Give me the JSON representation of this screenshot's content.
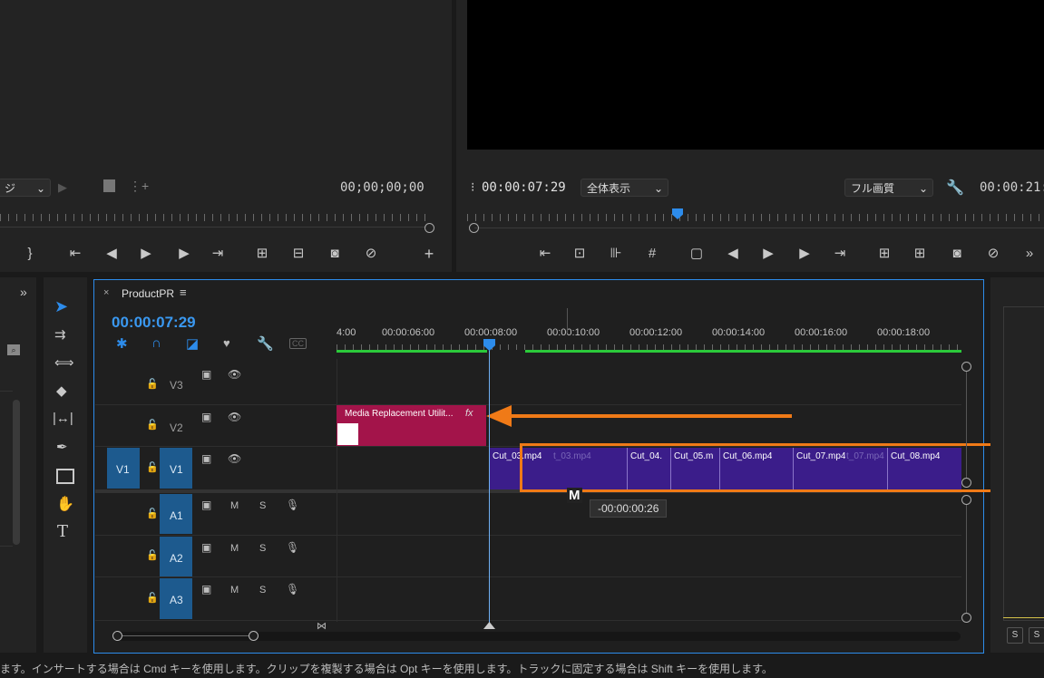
{
  "source_monitor": {
    "dropdown": "ジ",
    "timecode": "00;00;00;00"
  },
  "program_monitor": {
    "timecode": "00:00:07:29",
    "zoom": "全体表示",
    "quality": "フル画質",
    "end_timecode": "00:00:21:"
  },
  "timeline": {
    "tab_title": "ProductPR",
    "timecode": "00:00:07:29",
    "ruler": [
      "4:00",
      "00:00:06:00",
      "00:00:08:00",
      "00:00:10:00",
      "00:00:12:00",
      "00:00:14:00",
      "00:00:16:00",
      "00:00:18:00"
    ],
    "tracks": {
      "v3": "V3",
      "v2": "V2",
      "v1": "V1",
      "v1_source": "V1",
      "a1": "A1",
      "a2": "A2",
      "a3": "A3"
    },
    "audio_m": "M",
    "audio_s": "S",
    "adjustment_clip": {
      "name": "Media Replacement Utilit...",
      "fx": "fx"
    },
    "clips": [
      {
        "name": "Cut_03.mp4",
        "ghost": "t_03.mp4"
      },
      {
        "name": "Cut_04.",
        "ghost": ""
      },
      {
        "name": "Cut_05.m",
        "ghost": ""
      },
      {
        "name": "Cut_06.mp4",
        "ghost": ""
      },
      {
        "name": "Cut_07.mp4",
        "ghost": "t_07.mp4"
      },
      {
        "name": "Cut_08.mp4",
        "ghost": ""
      }
    ],
    "tooltip": "-00:00:00:26",
    "clip_icon_label": "M"
  },
  "right_panel": {
    "s1": "S",
    "s2": "S"
  },
  "status_bar": "ます。インサートする場合は Cmd キーを使用します。クリップを複製する場合は Opt キーを使用します。トラックに固定する場合は Shift キーを使用します。",
  "colors": {
    "accent_blue": "#2d8ceb",
    "highlight_orange": "#f07a17",
    "clip_purple": "#3b1d8a",
    "adjustment_red": "#a3144a",
    "track_blue": "#1d5a8e"
  }
}
